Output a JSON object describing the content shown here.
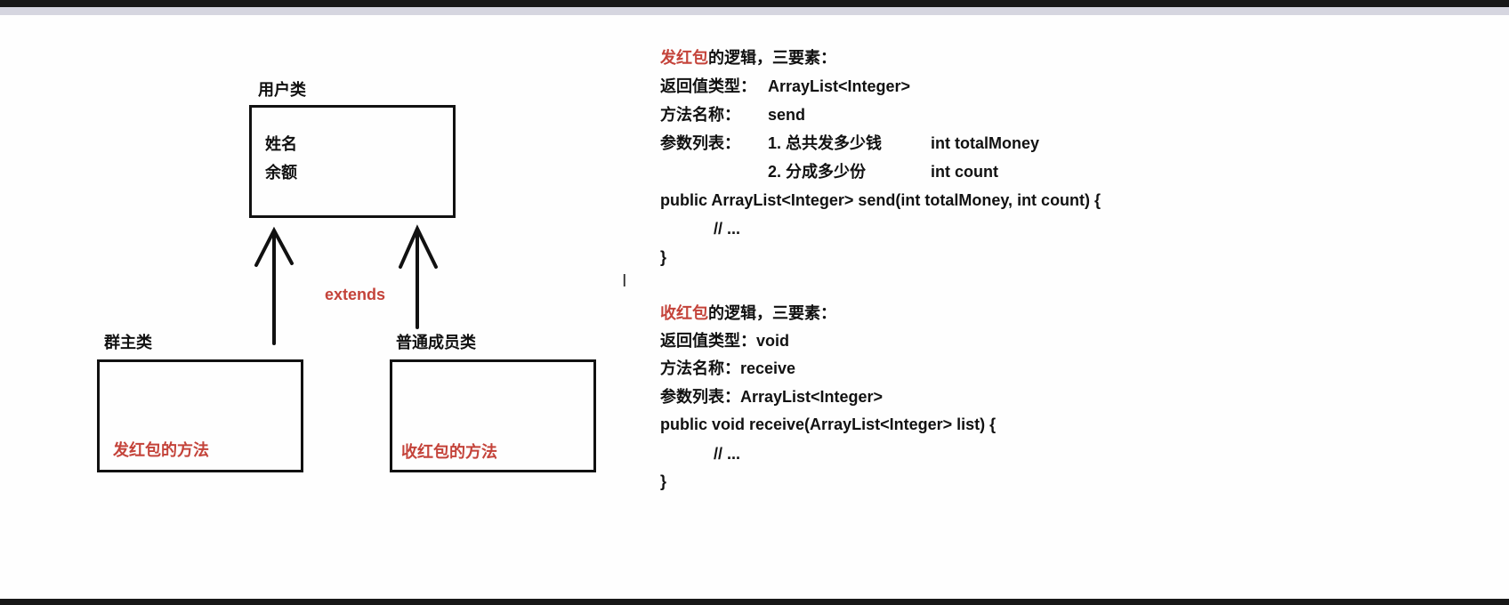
{
  "diagram": {
    "user_class": {
      "title": "用户类",
      "fields": [
        "姓名",
        "余额"
      ]
    },
    "owner_class": {
      "title": "群主类",
      "method": "发红包的方法"
    },
    "member_class": {
      "title": "普通成员类",
      "method": "收红包的方法"
    },
    "relation_label": "extends",
    "accent_color": "#c4433a"
  },
  "send_block": {
    "heading_red": "发红包",
    "heading_rest": "的逻辑，三要素：",
    "return_label": "返回值类型：",
    "return_value": "ArrayList<Integer>",
    "name_label": "方法名称：",
    "name_value": "send",
    "params_label": "参数列表：",
    "params": [
      {
        "desc": "1. 总共发多少钱",
        "code": "int totalMoney"
      },
      {
        "desc": "2. 分成多少份",
        "code": "int count"
      }
    ],
    "signature": "public ArrayList<Integer> send(int totalMoney, int count) {",
    "body": "// ...",
    "close": "}"
  },
  "receive_block": {
    "heading_red": "收红包",
    "heading_rest": "的逻辑，三要素：",
    "return_line": "返回值类型：void",
    "name_line": "方法名称：receive",
    "params_line": "参数列表：ArrayList<Integer>",
    "signature": "public void receive(ArrayList<Integer> list) {",
    "body": "// ...",
    "close": "}"
  }
}
